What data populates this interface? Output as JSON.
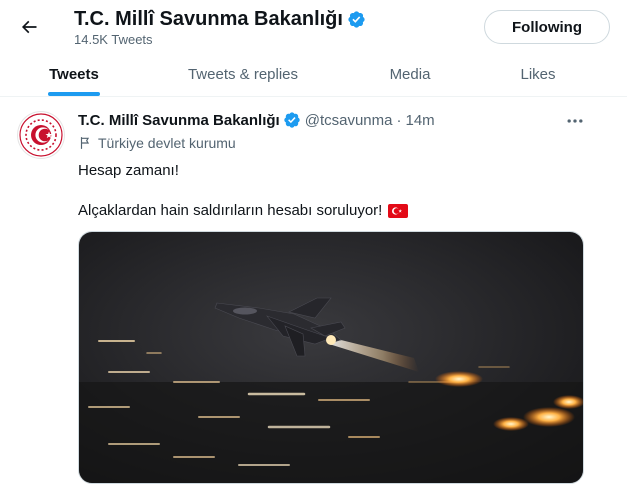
{
  "header": {
    "name": "T.C. Millî Savunma Bakanlığı",
    "tweet_count": "14.5K Tweets",
    "follow_label": "Following"
  },
  "tabs": [
    {
      "label": "Tweets",
      "active": true
    },
    {
      "label": "Tweets & replies",
      "active": false
    },
    {
      "label": "Media",
      "active": false
    },
    {
      "label": "Likes",
      "active": false
    }
  ],
  "tweet": {
    "name": "T.C. Millî Savunma Bakanlığı",
    "handle": "@tcsavunma",
    "separator": "·",
    "time": "14m",
    "label": "Türkiye devlet kurumu",
    "line1": "Hesap zamanı!",
    "line2": "Alçaklardan hain saldırıların hesabı soruluyor!",
    "media_alt": "Fighter jet taking off at night with afterburner"
  },
  "colors": {
    "accent": "#1d9bf0",
    "text": "#0f1419",
    "secondary": "#536471",
    "flag_red": "#e30a17"
  }
}
